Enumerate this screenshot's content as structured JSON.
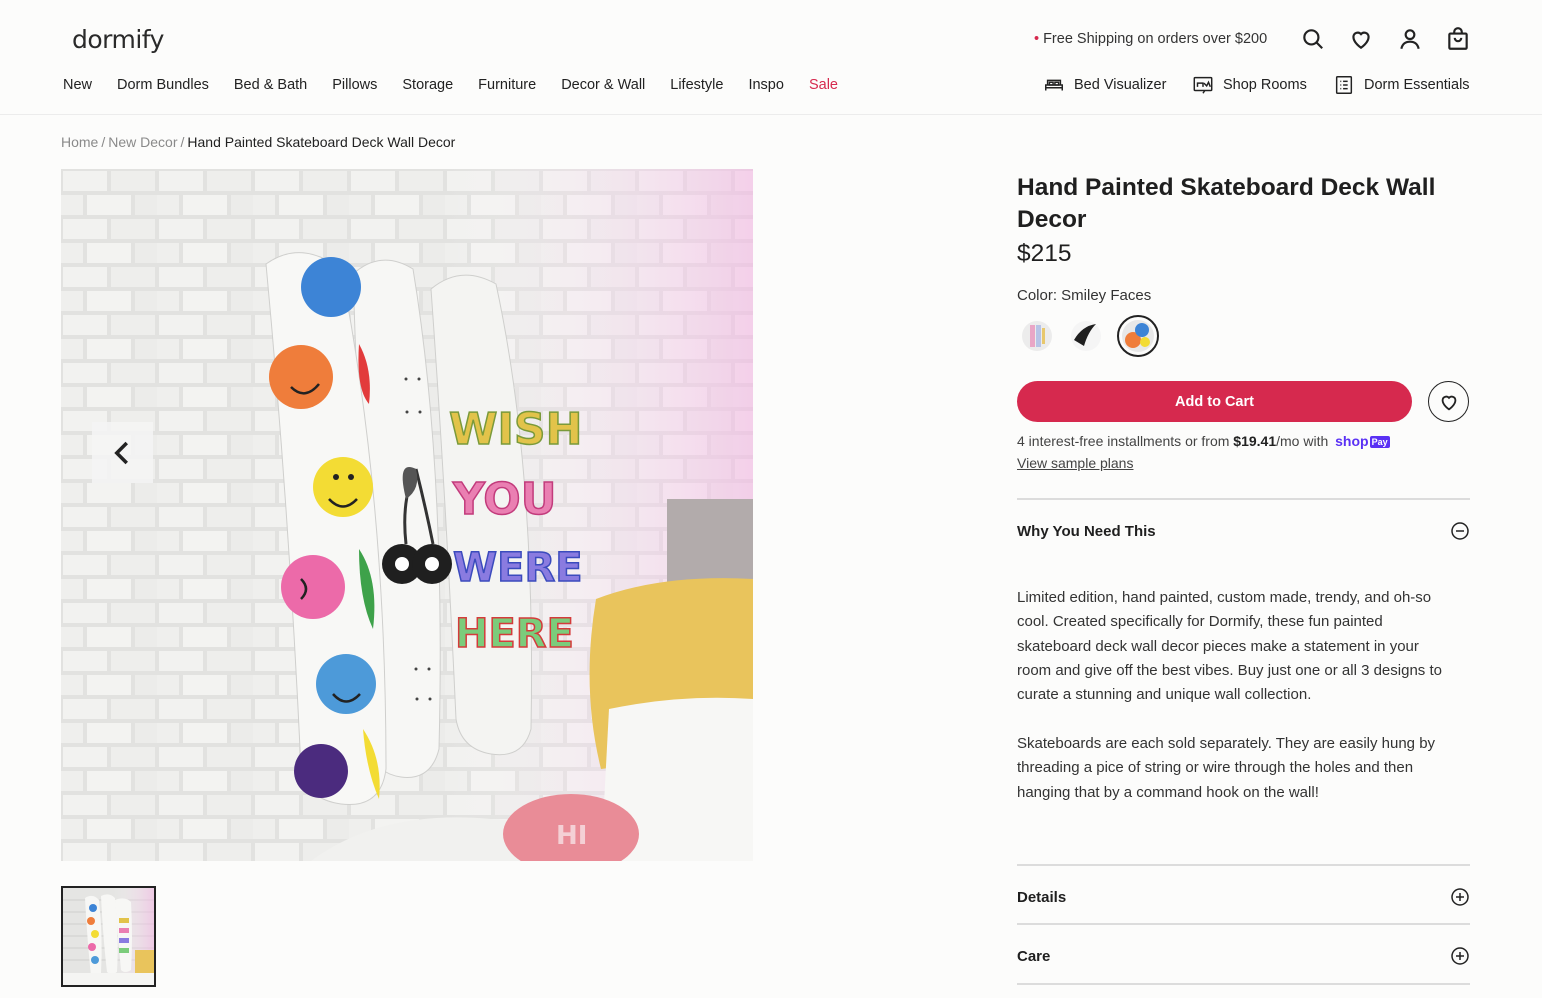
{
  "header": {
    "logo": "dormify",
    "promo": "Free Shipping on orders over $200",
    "nav": [
      "New",
      "Dorm Bundles",
      "Bed & Bath",
      "Pillows",
      "Storage",
      "Furniture",
      "Decor & Wall",
      "Lifestyle",
      "Inspo",
      "Sale"
    ],
    "utility": [
      "Bed Visualizer",
      "Shop Rooms",
      "Dorm Essentials"
    ],
    "icons": [
      "search-icon",
      "heart-icon",
      "account-icon",
      "bag-icon"
    ]
  },
  "breadcrumb": {
    "home": "Home",
    "sep1": "/",
    "category": "New Decor",
    "sep2": "/",
    "current": "Hand Painted Skateboard Deck Wall Decor"
  },
  "product": {
    "title": "Hand Painted Skateboard Deck Wall Decor",
    "price": "$215",
    "color_label": "Color: Smiley Faces",
    "swatches": [
      "multicolor",
      "black-white",
      "smiley-faces"
    ],
    "selected_swatch": "smiley-faces",
    "add_to_cart": "Add to Cart",
    "install_pre": "4 interest-free installments or from",
    "install_amount": "$19.41",
    "install_post": "/mo with",
    "shop_pay_brand": "shop",
    "shop_pay_badge": "Pay",
    "view_plans": "View sample plans"
  },
  "accordions": {
    "why": {
      "title": "Why You Need This",
      "para1": "Limited edition, hand painted, custom made, trendy, and oh-so cool. Created specifically for Dormify, these fun painted skateboard deck wall decor pieces make a statement in your room and give off the best vibes. Buy just one or all 3 designs to curate a stunning and unique wall collection.",
      "para2": "Skateboards are each sold separately. They are easily hung by threading a pice of string or wire through the holes and then hanging that by a command hook on the wall!"
    },
    "details": {
      "title": "Details"
    },
    "care": {
      "title": "Care"
    }
  },
  "image_text": {
    "deck2_words": [
      "WISH",
      "YOU",
      "WERE",
      "HERE"
    ],
    "pillow_word": "HI"
  },
  "colors": {
    "accent": "#d6294e",
    "shop_pay": "#5a31f4"
  }
}
